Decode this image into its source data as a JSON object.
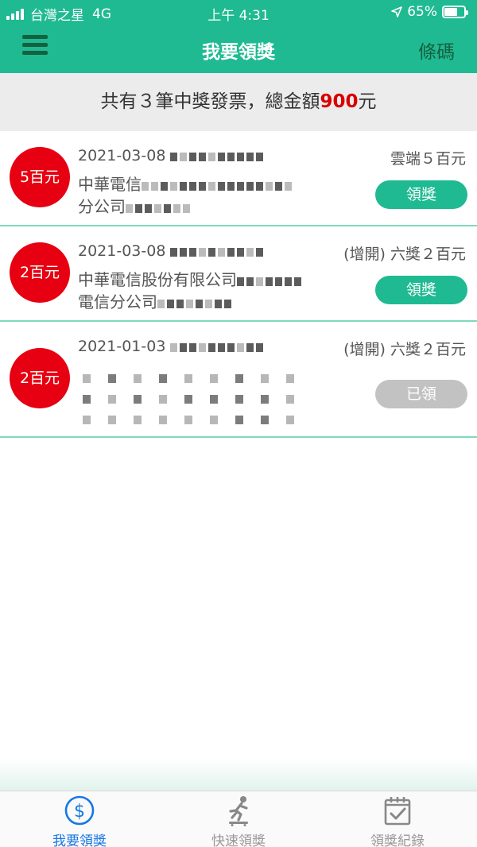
{
  "status_bar": {
    "carrier": "台灣之星",
    "network": "4G",
    "time": "上午 4:31",
    "battery": "65%",
    "battery_level": 0.65
  },
  "nav": {
    "title": "我要領獎",
    "barcode_label": "條碼",
    "menu_icon": "hamburger-menu-icon"
  },
  "summary": {
    "prefix": "共有３筆中獎發票，總金額",
    "amount": "900",
    "suffix": "元"
  },
  "invoices": [
    {
      "badge": "5百元",
      "date": "2021-03-08",
      "shop_line1": "中華電信",
      "shop_line2": "分公司",
      "prize": "雲端５百元",
      "button": "領獎",
      "claimed": false
    },
    {
      "badge": "2百元",
      "date": "2021-03-08",
      "shop_line1": "中華電信股份有限公司",
      "shop_line2": "電信分公司",
      "prize": "(增開) 六獎２百元",
      "button": "領獎",
      "claimed": false
    },
    {
      "badge": "2百元",
      "date": "2021-01-03",
      "shop_line1": "",
      "shop_line2": "",
      "prize": "(增開) 六獎２百元",
      "button": "已領",
      "claimed": true
    }
  ],
  "tabs": [
    {
      "label": "我要領獎",
      "icon": "dollar-circle-icon",
      "active": true
    },
    {
      "label": "快速領獎",
      "icon": "skateboard-runner-icon",
      "active": false
    },
    {
      "label": "領獎紀錄",
      "icon": "calendar-check-icon",
      "active": false
    }
  ],
  "colors": {
    "brand_green": "#1fba92",
    "dark_green": "#15603f",
    "badge_red": "#e60012",
    "amount_red": "#d90000",
    "tab_active_blue": "#1677e6",
    "claimed_gray": "#c2c2c2"
  }
}
